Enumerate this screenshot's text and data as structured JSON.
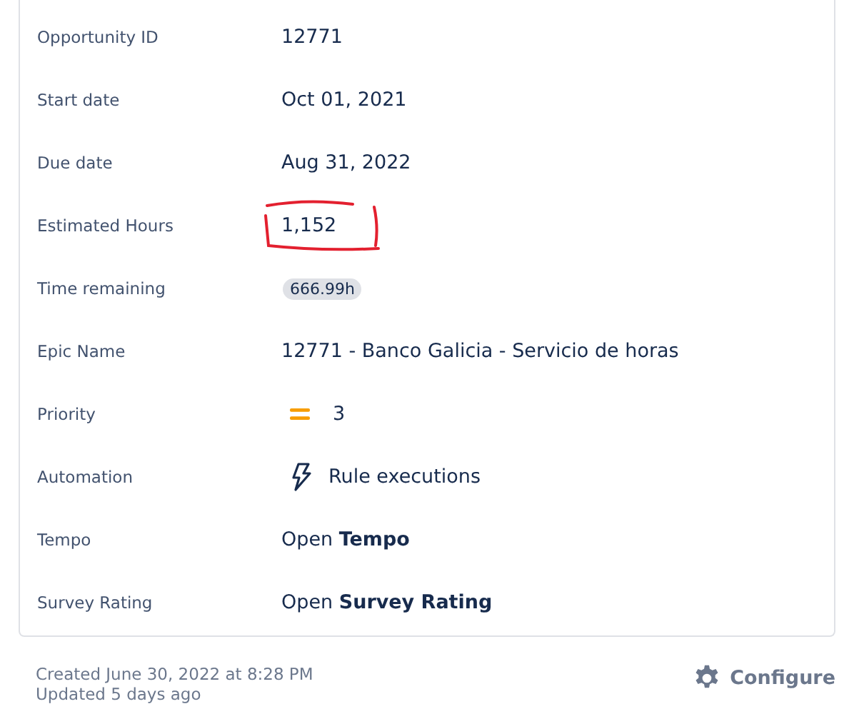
{
  "fields": [
    {
      "label": "Opportunity ID",
      "kind": "text",
      "value": "12771"
    },
    {
      "label": "Start date",
      "kind": "text",
      "value": "Oct 01, 2021"
    },
    {
      "label": "Due date",
      "kind": "text",
      "value": "Aug 31, 2022"
    },
    {
      "label": "Estimated Hours",
      "kind": "text",
      "value": "1,152",
      "circled": true
    },
    {
      "label": "Time remaining",
      "kind": "badge",
      "value": "666.99h"
    },
    {
      "label": "Epic Name",
      "kind": "text",
      "value": "12771 - Banco Galicia - Servicio de horas"
    },
    {
      "label": "Priority",
      "kind": "priority",
      "value": "3"
    },
    {
      "label": "Automation",
      "kind": "automation",
      "value": "Rule executions"
    },
    {
      "label": "Tempo",
      "kind": "link",
      "value": "Open **Tempo**"
    },
    {
      "label": "Survey Rating",
      "kind": "link",
      "value": "Open **Survey Rating**"
    }
  ],
  "footer": {
    "created": "Created June 30, 2022 at 8:28 PM",
    "updated": "Updated 5 days ago",
    "configure": "Configure"
  }
}
